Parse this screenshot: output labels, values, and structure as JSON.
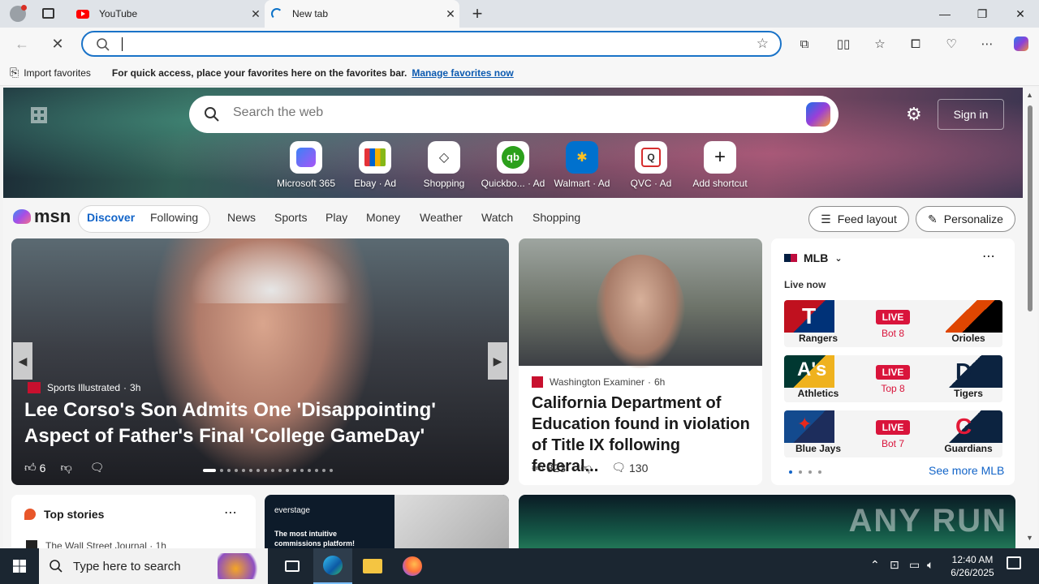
{
  "browser": {
    "tabs": [
      {
        "title": "YouTube"
      },
      {
        "title": "New tab"
      }
    ],
    "address_value": ""
  },
  "favorites_bar": {
    "import_label": "Import favorites",
    "hint": "For quick access, place your favorites here on the favorites bar.",
    "manage_link": "Manage favorites now"
  },
  "hero": {
    "search_placeholder": "Search the web",
    "signin_label": "Sign in",
    "shortcuts": [
      {
        "label": "Microsoft 365",
        "icon": "microsoft365-icon"
      },
      {
        "label": "Ebay · Ad",
        "icon": "ebay-icon"
      },
      {
        "label": "Shopping",
        "icon": "shopping-tag-icon"
      },
      {
        "label": "Quickbo... · Ad",
        "icon": "quickbooks-icon"
      },
      {
        "label": "Walmart · Ad",
        "icon": "walmart-icon"
      },
      {
        "label": "QVC · Ad",
        "icon": "qvc-icon"
      },
      {
        "label": "Add shortcut",
        "icon": "plus-icon"
      }
    ]
  },
  "msn_nav": {
    "logo": "msn",
    "tabs": [
      "Discover",
      "Following"
    ],
    "links": [
      "News",
      "Sports",
      "Play",
      "Money",
      "Weather",
      "Watch",
      "Shopping"
    ],
    "feed_layout": "Feed layout",
    "personalize": "Personalize"
  },
  "big_story": {
    "source": "Sports Illustrated",
    "age": "3h",
    "headline": "Lee Corso's Son Admits One 'Disappointing' Aspect of Father's Final 'College GameDay'",
    "likes": "6"
  },
  "mid_story": {
    "source": "Washington Examiner",
    "age": "6h",
    "headline": "California Department of Education found in violation of Title IX following federal...",
    "likes": "823",
    "comments": "130"
  },
  "mlb": {
    "title": "MLB",
    "live_now": "Live now",
    "games": [
      {
        "away": "Rangers",
        "home": "Orioles",
        "status": "LIVE",
        "inning": "Bot 8"
      },
      {
        "away": "Athletics",
        "home": "Tigers",
        "status": "LIVE",
        "inning": "Top 8"
      },
      {
        "away": "Blue Jays",
        "home": "Guardians",
        "status": "LIVE",
        "inning": "Bot 7"
      }
    ],
    "see_more": "See more MLB"
  },
  "top_stories": {
    "title": "Top stories",
    "first_source": "The Wall Street Journal · 1h"
  },
  "ad_card": {
    "brand": "everstage",
    "text": "The most intuitive commissions platform!"
  },
  "watermark": "ANY RUN",
  "taskbar": {
    "search_placeholder": "Type here to search",
    "time": "12:40 AM",
    "date": "6/26/2025"
  }
}
